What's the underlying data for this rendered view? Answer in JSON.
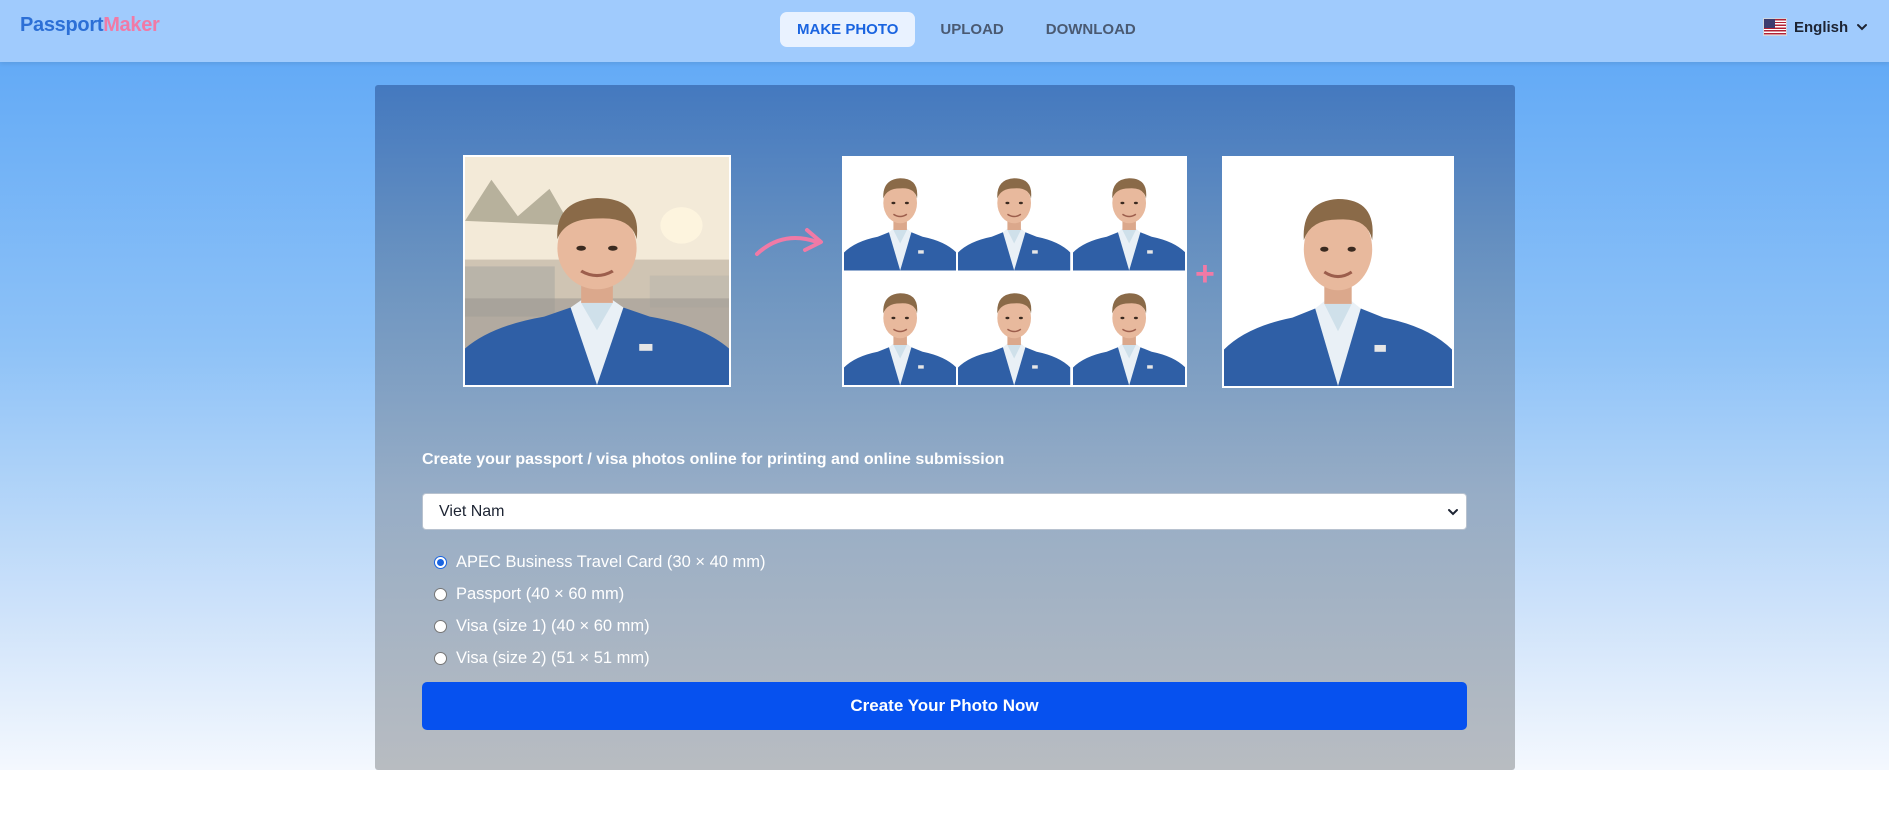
{
  "brand": {
    "part1": "Passport",
    "part2": "Maker"
  },
  "nav": {
    "items": [
      {
        "label": "MAKE PHOTO",
        "active": true
      },
      {
        "label": "UPLOAD",
        "active": false
      },
      {
        "label": "DOWNLOAD",
        "active": false
      }
    ]
  },
  "language": {
    "label": "English",
    "flag_icon": "us-flag-icon"
  },
  "hero": {
    "source_photo_icon": "portrait-photo",
    "arrow_icon": "curved-arrow-icon",
    "plus_symbol": "+"
  },
  "form": {
    "tagline": "Create your passport / visa photos online for printing and online submission",
    "country": "Viet Nam",
    "photo_types": [
      {
        "label": "APEC Business Travel Card (30 × 40 mm)",
        "checked": true
      },
      {
        "label": "Passport (40 × 60 mm)",
        "checked": false
      },
      {
        "label": "Visa (size 1) (40 × 60 mm)",
        "checked": false
      },
      {
        "label": "Visa (size 2) (51 × 51 mm)",
        "checked": false
      }
    ],
    "submit_label": "Create Your Photo Now"
  },
  "colors": {
    "accent": "#0651ef",
    "brand_pink": "#f07aa6",
    "brand_blue": "#2c6fd6",
    "header_bg": "#a0cbfd"
  }
}
